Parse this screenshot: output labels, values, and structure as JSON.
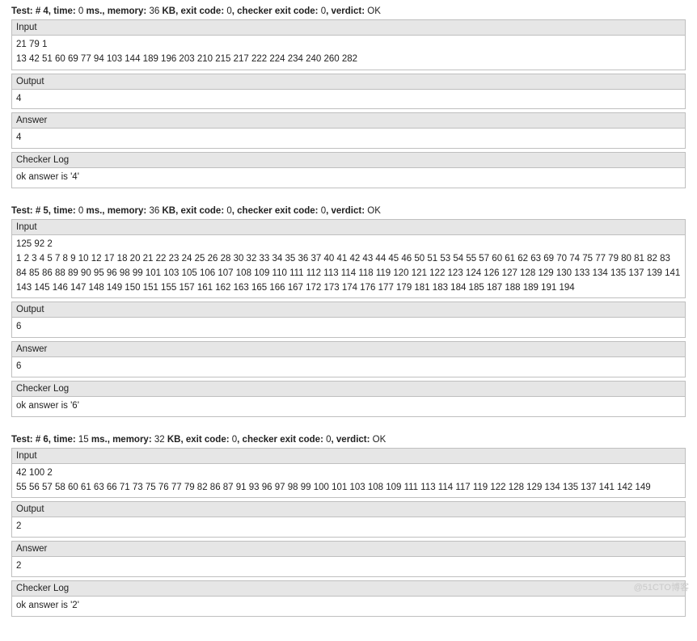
{
  "watermark": "@51CTO博客",
  "labels": {
    "test": "Test: #",
    "time": ", time:",
    "time_unit": "ms., memory:",
    "mem_unit": "KB, exit code:",
    "checker_exit": ", checker exit code:",
    "verdict": ", verdict:",
    "input": "Input",
    "output": "Output",
    "answer": "Answer",
    "checker_log": "Checker Log"
  },
  "tests": [
    {
      "num": "4",
      "time": "0",
      "memory": "36",
      "exit_code": "0",
      "checker_exit_code": "0",
      "verdict": "OK",
      "input": "21 79 1\n13 42 51 60 69 77 94 103 144 189 196 203 210 215 217 222 224 234 240 260 282",
      "output": "4",
      "answer": "4",
      "checker_log": "ok answer is '4'"
    },
    {
      "num": "5",
      "time": "0",
      "memory": "36",
      "exit_code": "0",
      "checker_exit_code": "0",
      "verdict": "OK",
      "input": "125 92 2\n1 2 3 4 5 7 8 9 10 12 17 18 20 21 22 23 24 25 26 28 30 32 33 34 35 36 37 40 41 42 43 44 45 46 50 51 53 54 55 57 60 61 62 63 69 70 74 75 77 79 80 81 82 83 84 85 86 88 89 90 95 96 98 99 101 103 105 106 107 108 109 110 111 112 113 114 118 119 120 121 122 123 124 126 127 128 129 130 133 134 135 137 139 141 143 145 146 147 148 149 150 151 155 157 161 162 163 165 166 167 172 173 174 176 177 179 181 183 184 185 187 188 189 191 194",
      "output": "6",
      "answer": "6",
      "checker_log": "ok answer is '6'"
    },
    {
      "num": "6",
      "time": "15",
      "memory": "32",
      "exit_code": "0",
      "checker_exit_code": "0",
      "verdict": "OK",
      "input": "42 100 2\n55 56 57 58 60 61 63 66 71 73 75 76 77 79 82 86 87 91 93 96 97 98 99 100 101 103 108 109 111 113 114 117 119 122 128 129 134 135 137 141 142 149",
      "output": "2",
      "answer": "2",
      "checker_log": "ok answer is '2'"
    }
  ]
}
